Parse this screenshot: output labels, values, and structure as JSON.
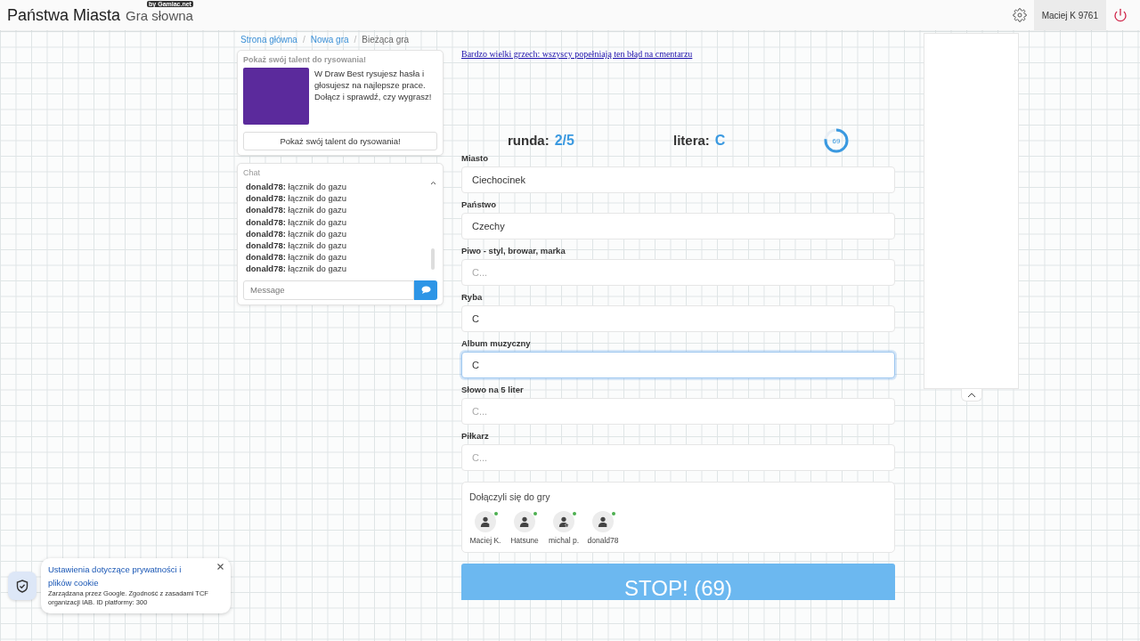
{
  "header": {
    "title": "Państwa Miasta",
    "subtitle": "Gra słowna",
    "badge": "by Gamiac.net",
    "user": "Maciej K 9761"
  },
  "breadcrumb_separators": [
    "/",
    "/"
  ],
  "breadcrumb": [
    {
      "label": "Strona główna",
      "current": false
    },
    {
      "label": "Nowa gra",
      "current": false
    },
    {
      "label": "Bieżąca gra",
      "current": true
    }
  ],
  "promo": {
    "title": "Pokaż swój talent do rysowania!",
    "text": "W Draw Best rysujesz hasła i głosujesz na najlepsze prace. Dołącz i sprawdź, czy wygrasz!",
    "button": "Pokaż swój talent do rysowania!"
  },
  "chat": {
    "title": "Chat",
    "placeholder": "Message",
    "messages": [
      {
        "user": "donald78:",
        "text": "łącznik do gazu"
      },
      {
        "user": "donald78:",
        "text": "łącznik do gazu"
      },
      {
        "user": "donald78:",
        "text": "łącznik do gazu"
      },
      {
        "user": "donald78:",
        "text": "łącznik do gazu"
      },
      {
        "user": "donald78:",
        "text": "łącznik do gazu"
      },
      {
        "user": "donald78:",
        "text": "łącznik do gazu"
      },
      {
        "user": "donald78:",
        "text": "łącznik do gazu"
      },
      {
        "user": "donald78:",
        "text": "łącznik do gazu"
      }
    ]
  },
  "ad_link": "Bardzo wielki grzech: wszyscy popełniają ten błąd na cmentarzu",
  "game": {
    "round_label": "runda:",
    "round": "2/5",
    "letter_label": "litera:",
    "letter": "C",
    "timer": {
      "text": "69",
      "level": 0.77
    }
  },
  "fields": [
    {
      "label": "Miasto",
      "value": "Ciechocinek",
      "focused": false
    },
    {
      "label": "Państwo",
      "value": "Czechy",
      "focused": false
    },
    {
      "label": "Piwo - styl, browar, marka",
      "placeholder": "C...",
      "focused": false
    },
    {
      "label": "Ryba",
      "value": "C",
      "focused": false
    },
    {
      "label": "Album muzyczny",
      "value": "C",
      "focused": true
    },
    {
      "label": "Słowo na 5 liter",
      "placeholder": "C...",
      "focused": false
    },
    {
      "label": "Piłkarz",
      "placeholder": "C...",
      "focused": false
    }
  ],
  "players": {
    "title": "Dołączyli się do gry",
    "items": [
      {
        "name": "Maciej K.",
        "kind": "player",
        "online": true
      },
      {
        "name": "Hatsune",
        "kind": "player",
        "online": true
      },
      {
        "name": "michal p.",
        "kind": "host",
        "online": true
      },
      {
        "name": "donald78",
        "kind": "player",
        "online": true
      }
    ]
  },
  "stop_button": "STOP! (69)",
  "cookie": {
    "title": "Ustawienia dotyczące prywatności i plików cookie",
    "text": "Zarządzana przez Google. Zgodność z zasadami TCF organizacji IAB. ID platformy: 300"
  }
}
